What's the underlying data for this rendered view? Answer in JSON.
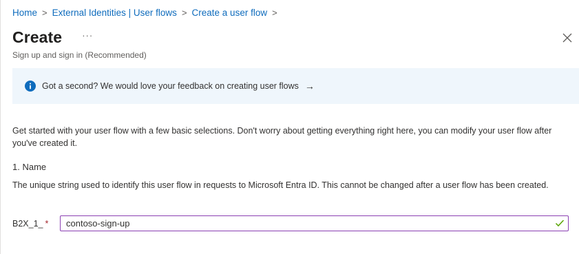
{
  "breadcrumb": {
    "items": [
      "Home",
      "External Identities | User flows",
      "Create a user flow"
    ],
    "separator": ">"
  },
  "header": {
    "title": "Create",
    "more_label": "···",
    "subtitle": "Sign up and sign in (Recommended)",
    "close_icon": "close-icon"
  },
  "banner": {
    "icon": "info-icon",
    "text": "Got a second? We would love your feedback on creating user flows",
    "arrow": "→"
  },
  "intro": {
    "text": "Get started with your user flow with a few basic selections. Don't worry about getting everything right here, you can modify your user flow after you've created it."
  },
  "name_section": {
    "heading": "1. Name",
    "description": "The unique string used to identify this user flow in requests to Microsoft Entra ID. This cannot be changed after a user flow has been created.",
    "field_prefix": "B2X_1_",
    "required_marker": "*",
    "value": "contoso-sign-up",
    "valid": true
  },
  "colors": {
    "link": "#0f6cbd",
    "banner_bg": "#eff6fc",
    "info_icon": "#0f6cbd",
    "input_border_focus": "#8a3fb2",
    "check": "#57a300",
    "required": "#a4262c"
  }
}
